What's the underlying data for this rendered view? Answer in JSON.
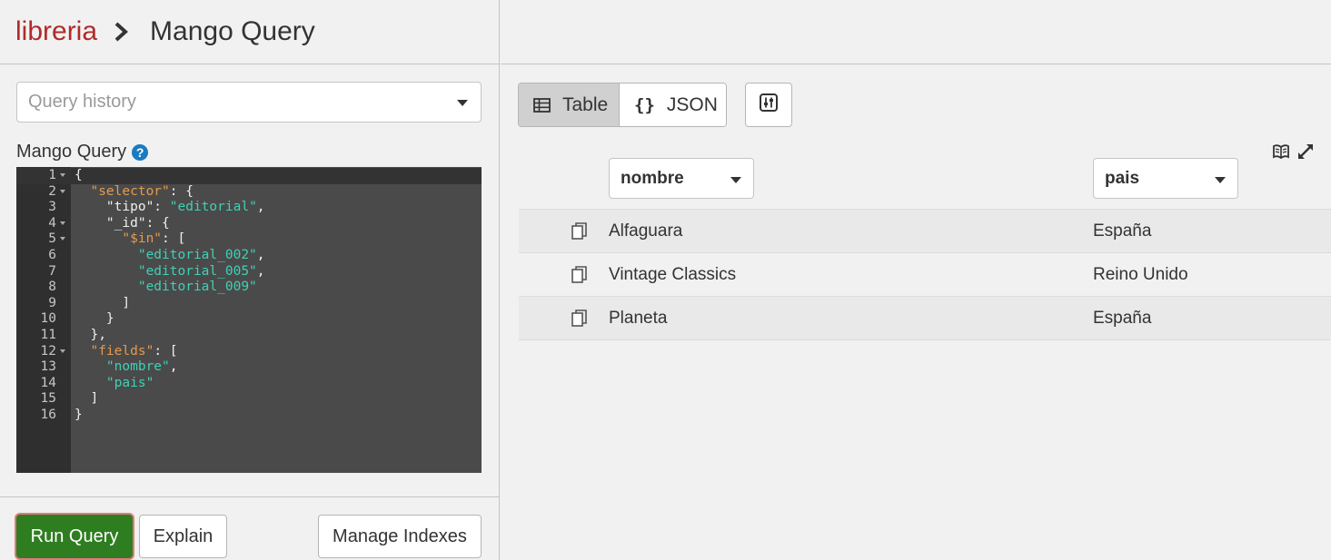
{
  "breadcrumb": {
    "database": "libreria",
    "page": "Mango Query"
  },
  "query_history": {
    "placeholder": "Query history"
  },
  "editor": {
    "label": "Mango Query",
    "lines": [
      {
        "n": "1",
        "fold": true,
        "html": "{"
      },
      {
        "n": "2",
        "fold": true,
        "html": "  <span class='k'>\"selector\"</span>: {"
      },
      {
        "n": "3",
        "fold": false,
        "html": "    \"tipo\": <span class='s'>\"editorial\"</span>,"
      },
      {
        "n": "4",
        "fold": true,
        "html": "    \"_id\": {"
      },
      {
        "n": "5",
        "fold": true,
        "html": "      <span class='k'>\"$in\"</span>: ["
      },
      {
        "n": "6",
        "fold": false,
        "html": "        <span class='s'>\"editorial_002\"</span>,"
      },
      {
        "n": "7",
        "fold": false,
        "html": "        <span class='s'>\"editorial_005\"</span>,"
      },
      {
        "n": "8",
        "fold": false,
        "html": "        <span class='s'>\"editorial_009\"</span>"
      },
      {
        "n": "9",
        "fold": false,
        "html": "      ]"
      },
      {
        "n": "10",
        "fold": false,
        "html": "    }"
      },
      {
        "n": "11",
        "fold": false,
        "html": "  },"
      },
      {
        "n": "12",
        "fold": true,
        "html": "  <span class='k'>\"fields\"</span>: ["
      },
      {
        "n": "13",
        "fold": false,
        "html": "    <span class='s'>\"nombre\"</span>,"
      },
      {
        "n": "14",
        "fold": false,
        "html": "    <span class='s'>\"pais\"</span>"
      },
      {
        "n": "15",
        "fold": false,
        "html": "  ]"
      },
      {
        "n": "16",
        "fold": false,
        "html": "}"
      }
    ]
  },
  "actions": {
    "run": "Run Query",
    "explain": "Explain",
    "manage_indexes": "Manage Indexes"
  },
  "view_toggle": {
    "table": "Table",
    "json": "JSON",
    "selected": "Table"
  },
  "columns": [
    {
      "label": "nombre"
    },
    {
      "label": "pais"
    }
  ],
  "rows": [
    {
      "nombre": "Alfaguara",
      "pais": "España"
    },
    {
      "nombre": "Vintage Classics",
      "pais": "Reino Unido"
    },
    {
      "nombre": "Planeta",
      "pais": "España"
    }
  ],
  "colors": {
    "database": "#b12a2a",
    "run_button": "#2f7d21",
    "help_icon": "#1a7bbf",
    "editor_bg": "#4a4a4a",
    "key": "#e59a4c",
    "string": "#3fd1b4"
  }
}
